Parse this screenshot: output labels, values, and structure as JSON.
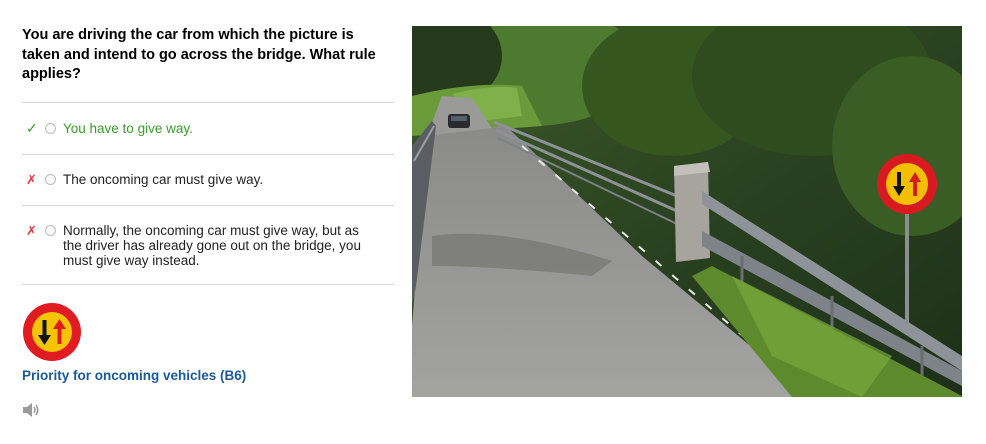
{
  "question": "You are driving the car from which the picture is taken and intend to go across the bridge. What rule applies?",
  "answers": [
    {
      "status": "correct",
      "mark": "✓",
      "text": "You have to give way."
    },
    {
      "status": "wrong",
      "mark": "✗",
      "text": "The oncoming car must give way."
    },
    {
      "status": "wrong",
      "mark": "✗",
      "text": "Normally, the oncoming car must give way, but as the driver has already gone out on the bridge, you must give way instead."
    }
  ],
  "sign": {
    "caption": "Priority for oncoming vehicles (B6)",
    "icon": "priority-oncoming-sign-icon"
  },
  "audio": {
    "icon": "speaker-icon"
  },
  "colors": {
    "correct": "#3a9b2a",
    "wrong": "#e23a3a",
    "caption": "#1a5a99",
    "sign_red": "#e01b22",
    "sign_yellow": "#f6c400"
  }
}
